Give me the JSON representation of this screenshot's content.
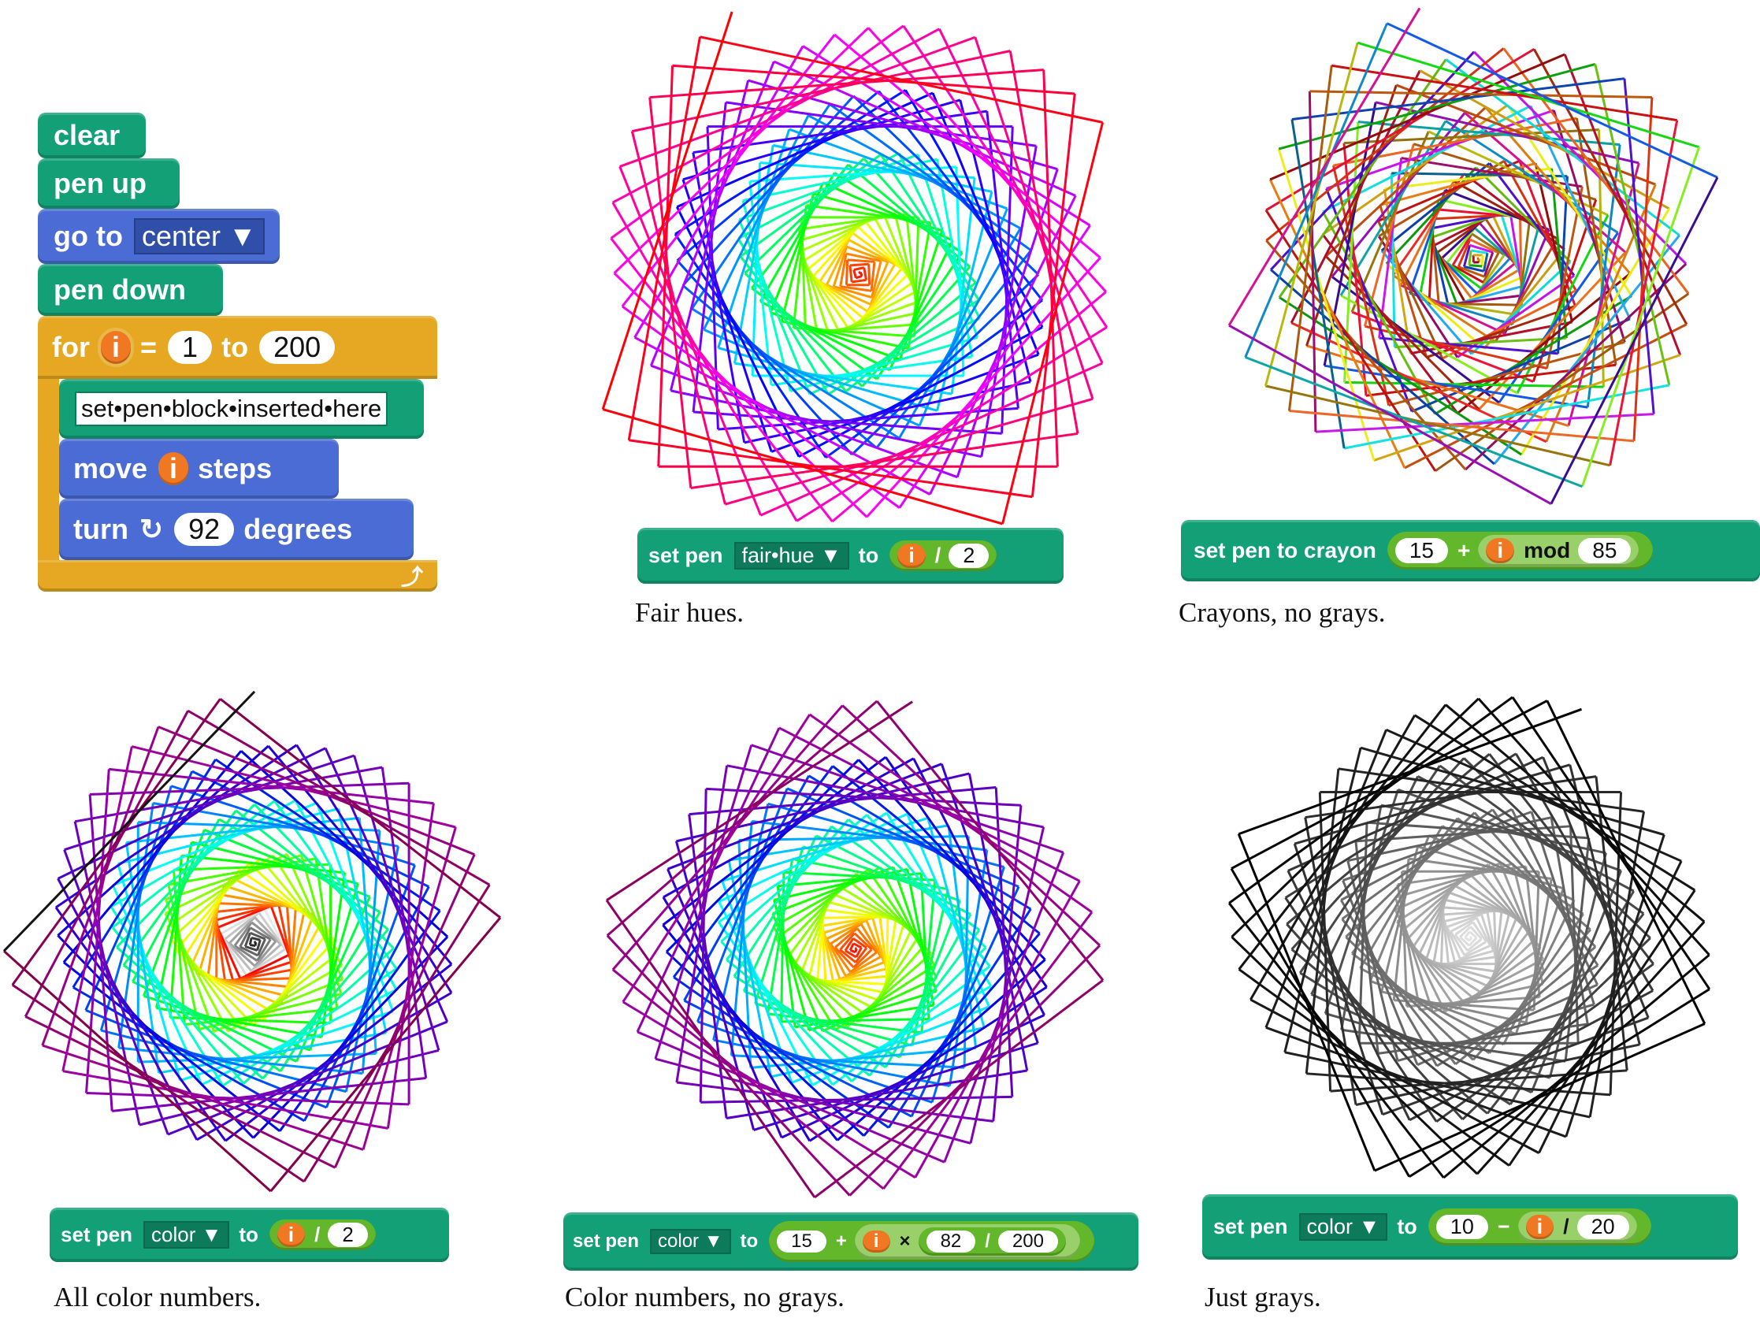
{
  "script": {
    "clear": "clear",
    "pen_up": "pen up",
    "go_to": "go to",
    "go_to_target": "center",
    "pen_down": "pen down",
    "for": "for",
    "loop_var": "i",
    "equals": "=",
    "from": "1",
    "to": "to",
    "limit": "200",
    "placeholder": "set•pen•block•inserted•here",
    "move": "move",
    "steps": "steps",
    "turn": "turn",
    "turn_icon": "rotate-clockwise-icon",
    "degrees_value": "92",
    "degrees": "degrees",
    "loop_icon": "loop-arrow-icon"
  },
  "colors": {
    "pen": "#14a077",
    "motion": "#4a6cd4",
    "control": "#e6a822",
    "variable": "#f07822",
    "operator": "#62b82a"
  },
  "panels": [
    {
      "id": "fair",
      "caption": "Fair hues.",
      "block": {
        "set": "set pen",
        "option": "fair•hue",
        "to": "to",
        "var": "i",
        "op": "/",
        "num": "2"
      }
    },
    {
      "id": "crayon",
      "caption": "Crayons, no grays.",
      "block": {
        "set": "set pen to crayon",
        "num1": "15",
        "op1": "+",
        "var": "i",
        "op2": "mod",
        "num2": "85"
      }
    },
    {
      "id": "allcolor",
      "caption": "All color numbers.",
      "block": {
        "set": "set pen",
        "option": "color",
        "to": "to",
        "var": "i",
        "op": "/",
        "num": "2"
      }
    },
    {
      "id": "nogray",
      "caption": "Color numbers, no grays.",
      "block": {
        "set": "set pen",
        "option": "color",
        "to": "to",
        "num1": "15",
        "op1": "+",
        "var": "i",
        "op2": "×",
        "num2": "82",
        "op3": "/",
        "num3": "200"
      }
    },
    {
      "id": "grays",
      "caption": "Just grays.",
      "block": {
        "set": "set pen",
        "option": "color",
        "to": "to",
        "num1": "10",
        "op1": "−",
        "var": "i",
        "op2": "/",
        "num2": "20"
      }
    }
  ]
}
